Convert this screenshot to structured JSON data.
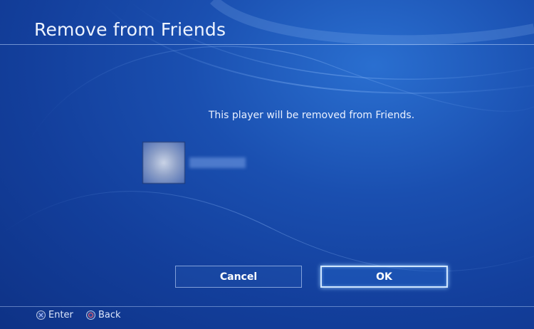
{
  "dialog": {
    "title": "Remove from Friends",
    "message": "This player will be removed from Friends."
  },
  "buttons": {
    "cancel_label": "Cancel",
    "ok_label": "OK"
  },
  "footer": {
    "enter_label": "Enter",
    "back_label": "Back",
    "enter_icon": "cross-button-icon",
    "back_icon": "circle-button-icon"
  },
  "colors": {
    "background": "#1a4fb0",
    "focus_outline": "#cfe6ff",
    "circle_glyph": "#ff5e6a"
  }
}
